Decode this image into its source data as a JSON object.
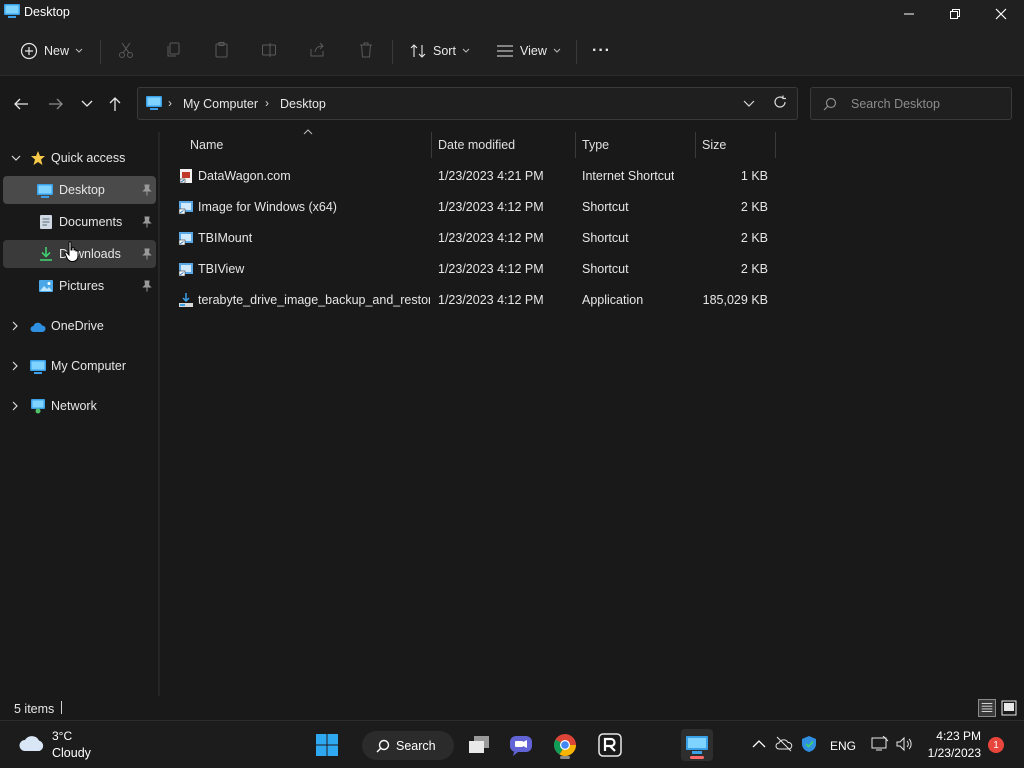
{
  "window": {
    "title": "Desktop",
    "controls": [
      "minimize",
      "restore",
      "close"
    ]
  },
  "commandbar": {
    "new_label": "New",
    "sort_label": "Sort",
    "view_label": "View",
    "more_label": "···",
    "icons": [
      "cut-icon",
      "copy-icon",
      "paste-icon",
      "rename-icon",
      "share-icon",
      "delete-icon"
    ]
  },
  "address": {
    "crumbs": [
      "My Computer",
      "Desktop"
    ],
    "search_placeholder": "Search Desktop"
  },
  "navpane": {
    "quick_access_label": "Quick access",
    "quick_items": [
      {
        "label": "Desktop",
        "icon": "desktop-icon",
        "pinned": true,
        "selected": true
      },
      {
        "label": "Documents",
        "icon": "documents-icon",
        "pinned": true,
        "selected": false
      },
      {
        "label": "Downloads",
        "icon": "downloads-icon",
        "pinned": true,
        "hovered": true
      },
      {
        "label": "Pictures",
        "icon": "pictures-icon",
        "pinned": true,
        "selected": false
      }
    ],
    "roots": [
      {
        "label": "OneDrive",
        "icon": "onedrive-icon"
      },
      {
        "label": "My Computer",
        "icon": "computer-icon"
      },
      {
        "label": "Network",
        "icon": "network-icon"
      }
    ]
  },
  "filelist": {
    "columns": [
      "Name",
      "Date modified",
      "Type",
      "Size"
    ],
    "rows": [
      {
        "name": "DataWagon.com",
        "date": "1/23/2023 4:21 PM",
        "type": "Internet Shortcut",
        "size": "1 KB",
        "icon": "internet-shortcut-icon"
      },
      {
        "name": "Image for Windows (x64)",
        "date": "1/23/2023 4:12 PM",
        "type": "Shortcut",
        "size": "2 KB",
        "icon": "shortcut-icon"
      },
      {
        "name": "TBIMount",
        "date": "1/23/2023 4:12 PM",
        "type": "Shortcut",
        "size": "2 KB",
        "icon": "shortcut-icon"
      },
      {
        "name": "TBIView",
        "date": "1/23/2023 4:12 PM",
        "type": "Shortcut",
        "size": "2 KB",
        "icon": "shortcut-icon"
      },
      {
        "name": "terabyte_drive_image_backup_and_restor...",
        "date": "1/23/2023 4:12 PM",
        "type": "Application",
        "size": "185,029 KB",
        "icon": "installer-icon"
      }
    ]
  },
  "status": {
    "items_text": "5 items"
  },
  "taskbar": {
    "weather_temp": "3°C",
    "weather_desc": "Cloudy",
    "search_label": "Search",
    "lang": "ENG",
    "time": "4:23 PM",
    "date": "1/23/2023",
    "notification_count": "1"
  },
  "colors": {
    "accent_blue": "#4cc2ff",
    "selection": "#4a4a4a",
    "badge_red": "#e8453c"
  }
}
